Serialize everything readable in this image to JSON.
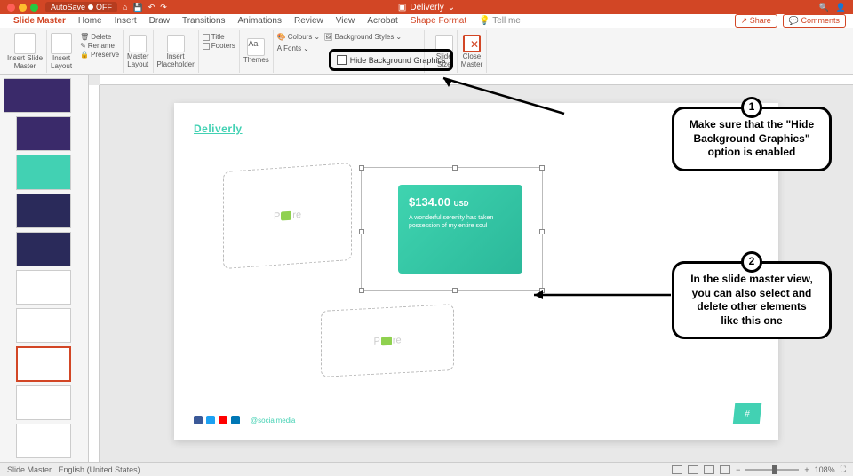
{
  "titlebar": {
    "autosave": "AutoSave",
    "autosave_state": "OFF",
    "doc": "Deliverly"
  },
  "tabs": {
    "slide_master": "Slide Master",
    "home": "Home",
    "insert": "Insert",
    "draw": "Draw",
    "transitions": "Transitions",
    "animations": "Animations",
    "review": "Review",
    "view": "View",
    "acrobat": "Acrobat",
    "shape_format": "Shape Format",
    "tell_me": "Tell me",
    "share": "Share",
    "comments": "Comments"
  },
  "ribbon": {
    "insert_slide_master": "Insert Slide\nMaster",
    "insert_layout": "Insert\nLayout",
    "delete": "Delete",
    "rename": "Rename",
    "preserve": "Preserve",
    "master_layout": "Master\nLayout",
    "insert_placeholder": "Insert\nPlaceholder",
    "title": "Title",
    "footers": "Footers",
    "themes": "Themes",
    "colours": "Colours",
    "fonts": "Fonts",
    "background_styles": "Background Styles",
    "hide_background": "Hide Background Graphics",
    "slide_size": "Slide\nSize",
    "close_master": "Close\nMaster"
  },
  "slide": {
    "brand": "Deliverly",
    "picture_label": "P",
    "picture_label2": "re",
    "price": "$134.00",
    "currency": "USD",
    "desc": "A wonderful serenity has taken possession of my entire soul",
    "social_handle": "@socialmedia"
  },
  "callouts": {
    "c1_num": "1",
    "c1_text": "Make sure that the \"Hide Background Graphics\" option is enabled",
    "c2_num": "2",
    "c2_text": "In the slide master view, you can also select and delete other elements like this one"
  },
  "status": {
    "mode": "Slide Master",
    "lang": "English (United States)",
    "zoom": "108%"
  }
}
